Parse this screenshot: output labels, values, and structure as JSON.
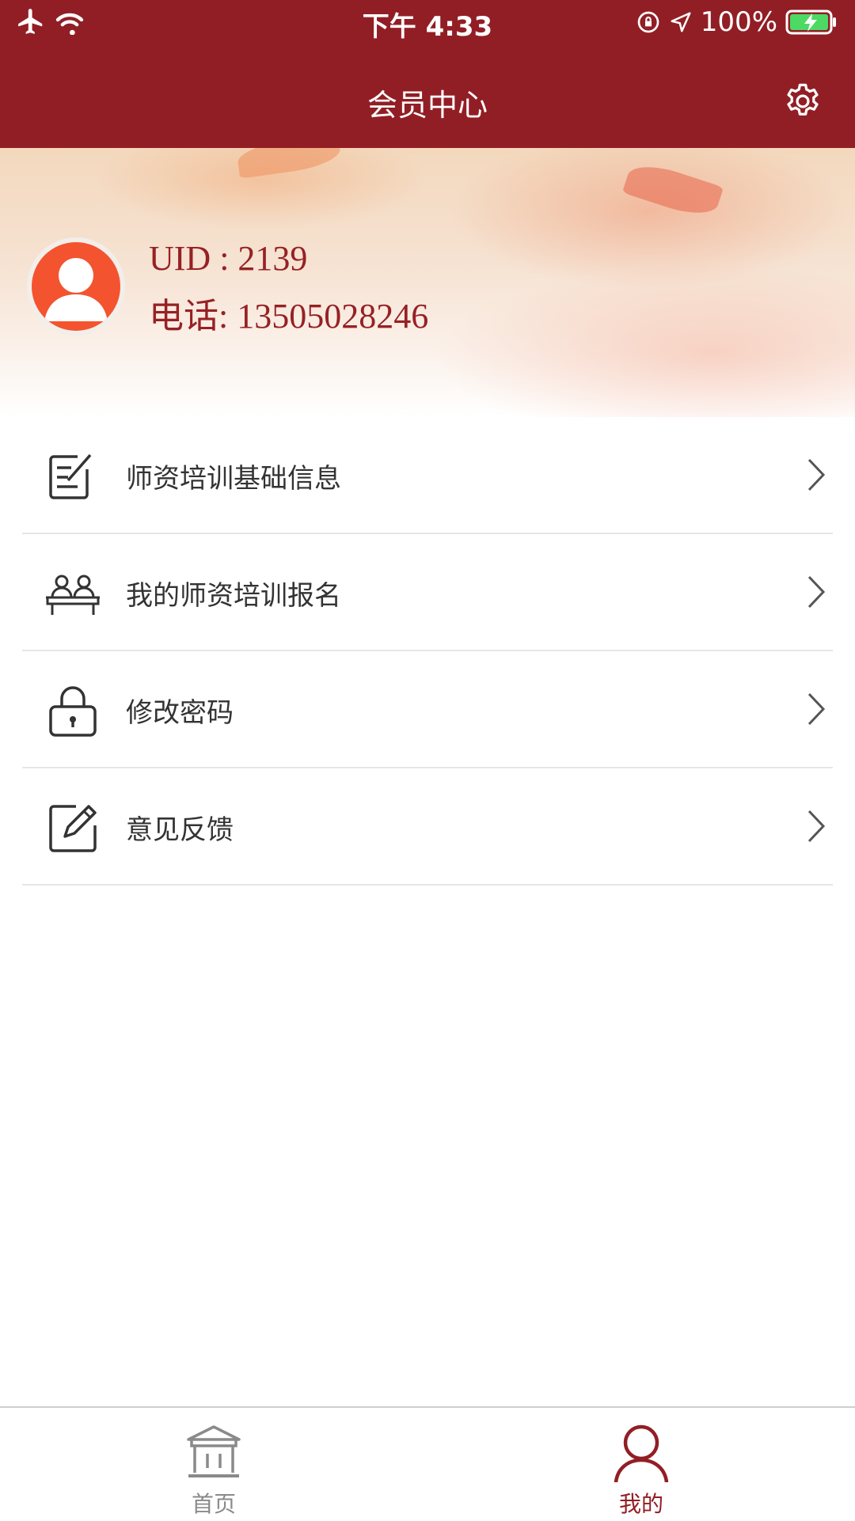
{
  "status_bar": {
    "time": "下午 4:33",
    "battery": "100%",
    "icons": [
      "airplane-icon",
      "wifi-icon",
      "rotation-lock-icon",
      "location-icon",
      "battery-charging-icon"
    ]
  },
  "header": {
    "title": "会员中心",
    "settings_icon": "gear-icon"
  },
  "profile": {
    "uid": "UID : 2139",
    "phone": "电话: 13505028246",
    "avatar_icon": "user-avatar-icon"
  },
  "menu": {
    "items": [
      {
        "label": "师资培训基础信息",
        "icon": "document-edit-icon"
      },
      {
        "label": "我的师资培训报名",
        "icon": "people-desk-icon"
      },
      {
        "label": "修改密码",
        "icon": "lock-icon"
      },
      {
        "label": "意见反馈",
        "icon": "pencil-square-icon"
      }
    ]
  },
  "tabbar": {
    "tabs": [
      {
        "label": "首页",
        "icon": "building-icon",
        "active": false
      },
      {
        "label": "我的",
        "icon": "person-icon",
        "active": true
      }
    ]
  },
  "colors": {
    "brand": "#921e25",
    "accent_text": "#962125",
    "avatar_bg": "#f4532f",
    "inactive_tab": "#8a8a8a"
  }
}
